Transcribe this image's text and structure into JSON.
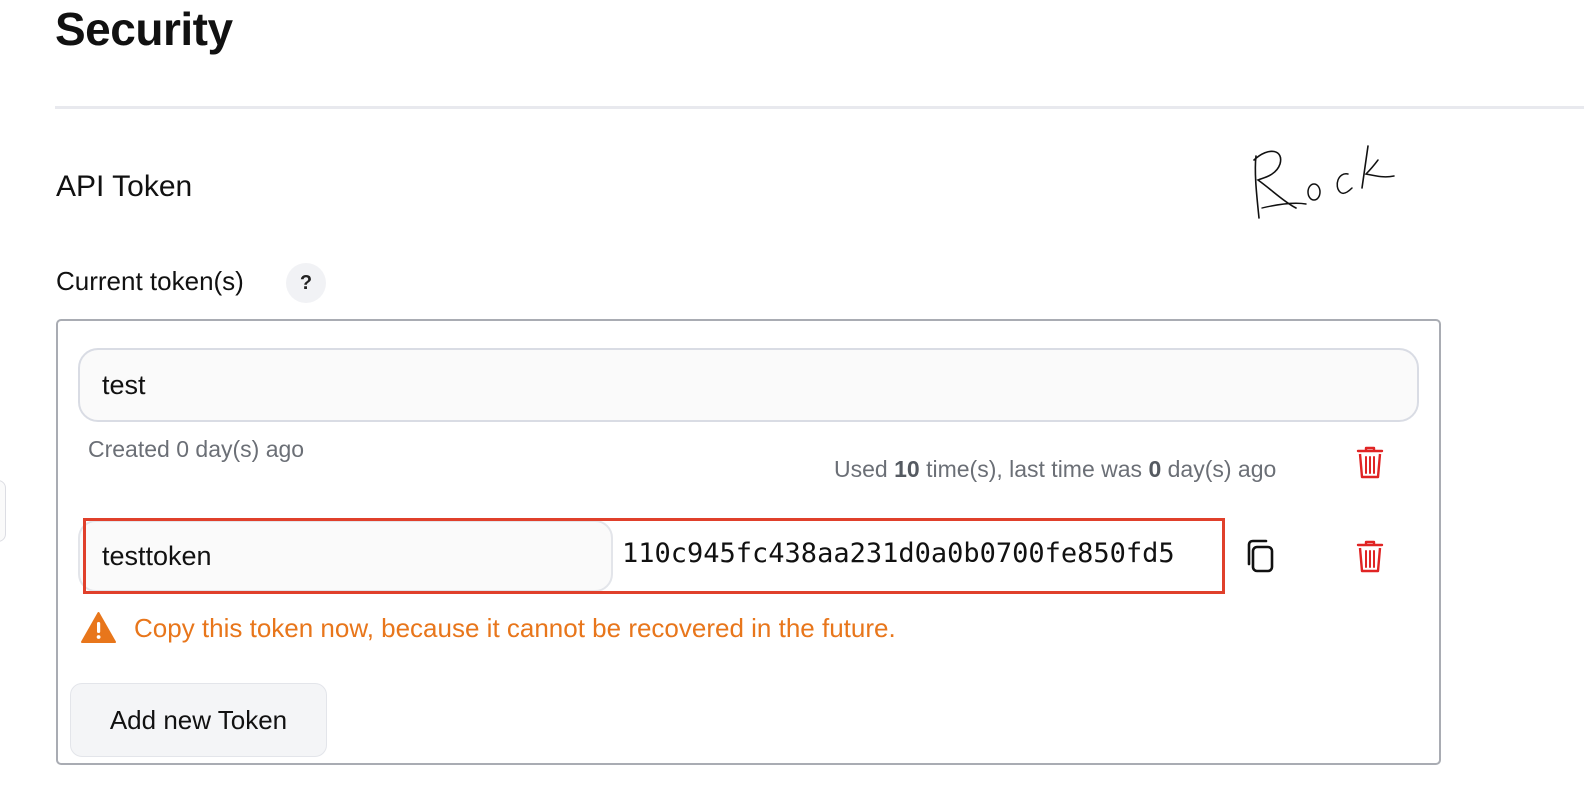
{
  "page": {
    "title": "Security"
  },
  "api_token": {
    "section_title": "API Token",
    "tokens_label": "Current token(s)",
    "help_badge": "?",
    "existing_token": {
      "name": "test",
      "created_text": "Created 0 day(s) ago",
      "usage_prefix": "Used ",
      "usage_count": "10",
      "usage_middle": " time(s), last time was ",
      "usage_days": "0",
      "usage_suffix": " day(s) ago",
      "delete_icon": "trash-icon"
    },
    "new_token": {
      "name": "testtoken",
      "value": "110c945fc438aa231d0a0b0700fe850fd5",
      "copy_icon": "copy-icon",
      "delete_icon": "trash-icon",
      "highlight_color": "#e0402b"
    },
    "warning": {
      "text": "Copy this token now, because it cannot be recovered in the future.",
      "icon": "warning-triangle-icon",
      "color": "#e8761b"
    },
    "add_button_label": "Add new Token"
  },
  "annotation": {
    "handwritten_signature": "Rock"
  },
  "colors": {
    "danger": "#e02424",
    "warning": "#e8761b",
    "highlight": "#e0402b",
    "muted_text": "#6b6f76"
  }
}
